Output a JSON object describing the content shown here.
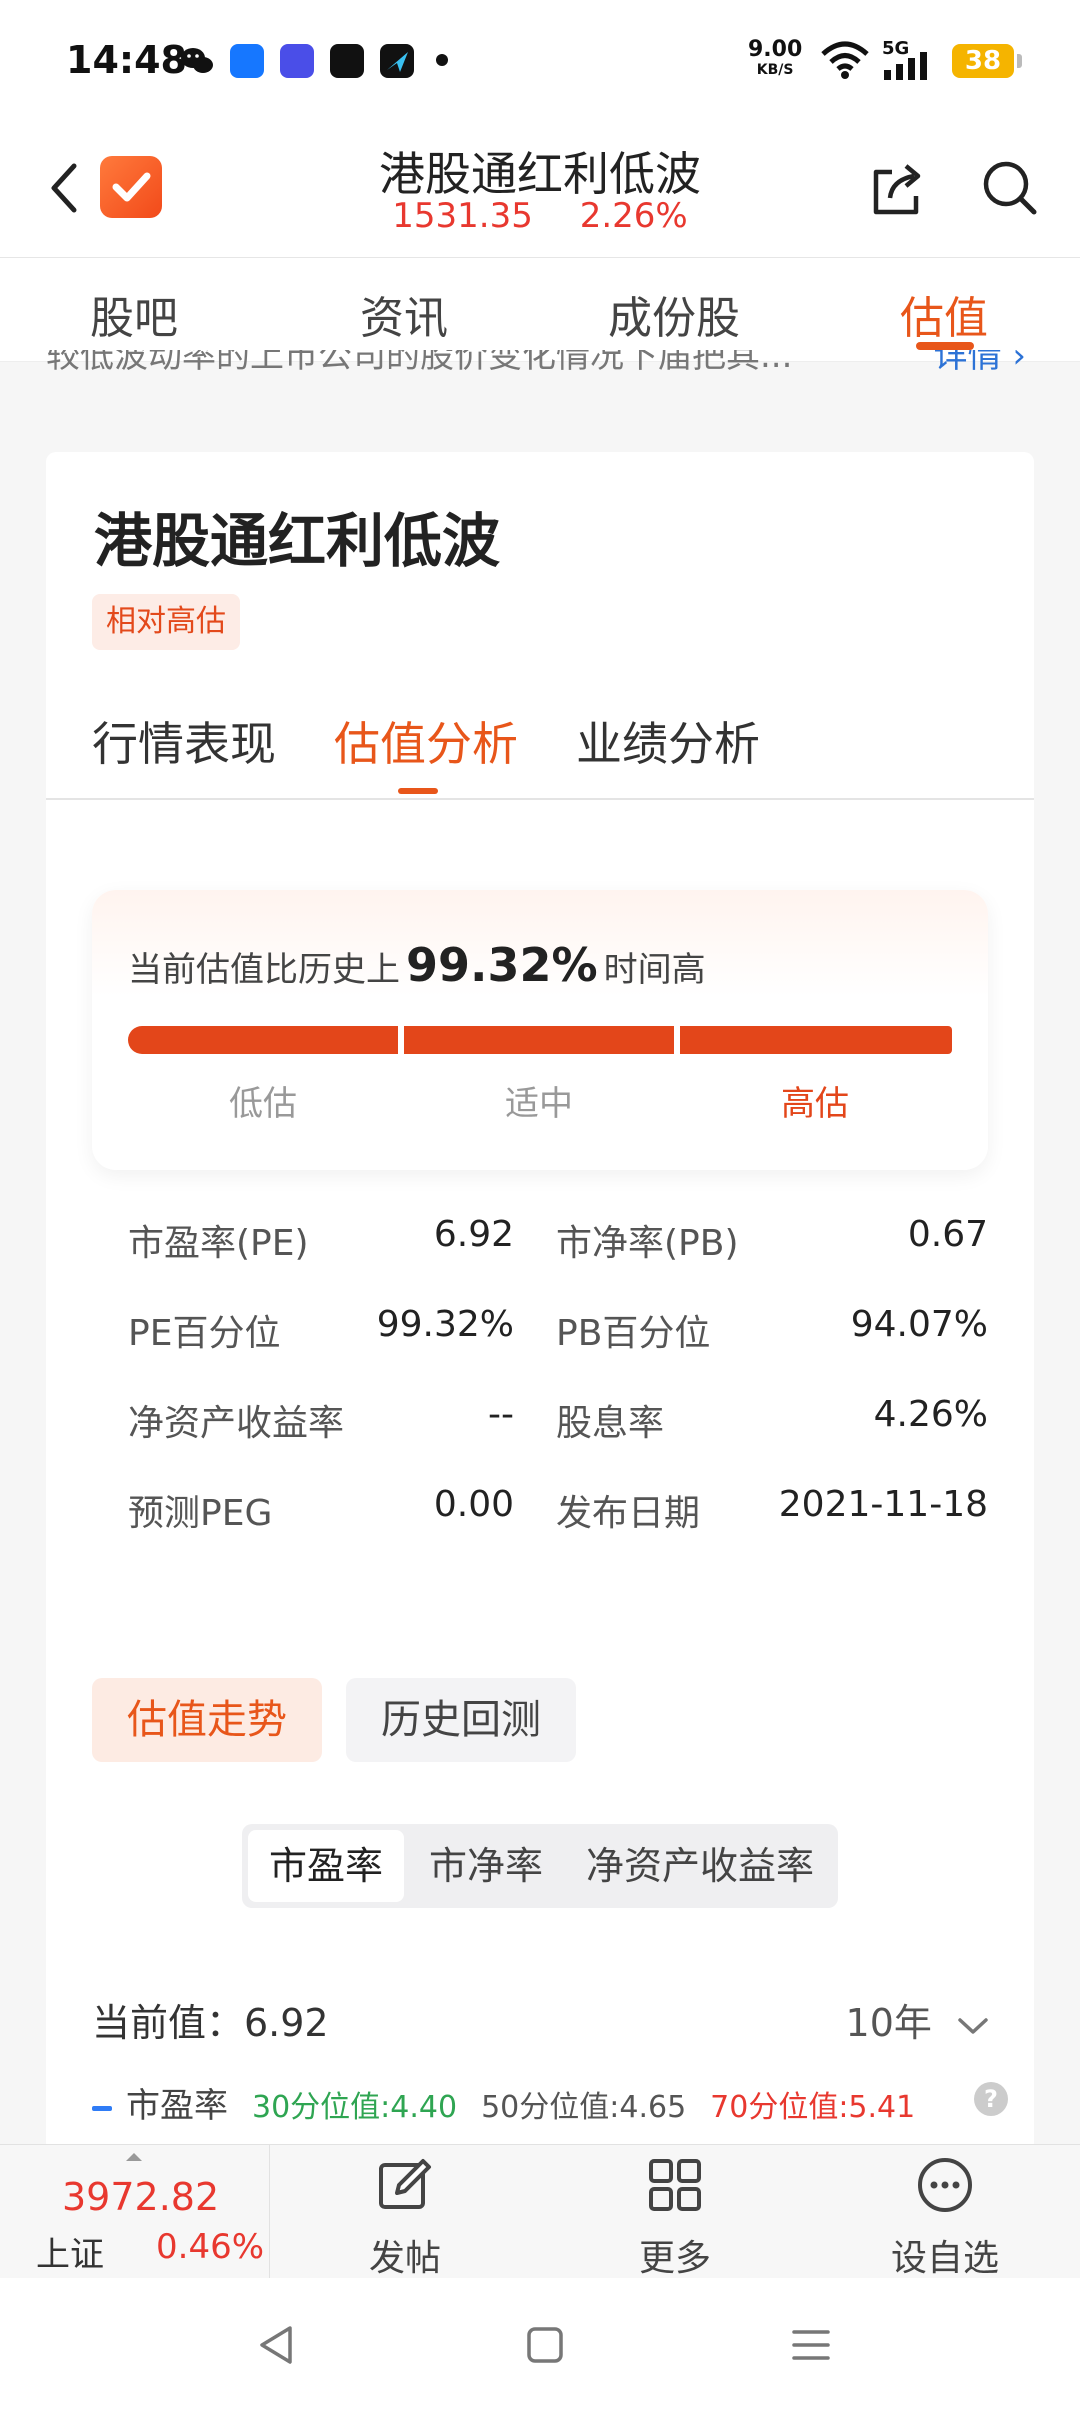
{
  "status_bar": {
    "time": "14:48",
    "net_speed": "9.00",
    "net_unit": "KB/S",
    "network": "5G",
    "battery": "38"
  },
  "header": {
    "title": "港股通红利低波",
    "price": "1531.35",
    "change_pct": "2.26%"
  },
  "top_tabs": [
    "股吧",
    "资讯",
    "成份股",
    "估值"
  ],
  "intro": {
    "text": "较低波动率的上市公司的股价变化情况下届把其...",
    "more": "详情 ›"
  },
  "card": {
    "title": "港股通红利低波",
    "badge": "相对高估",
    "sub_tabs": [
      "行情表现",
      "估值分析",
      "业绩分析"
    ],
    "gauge": {
      "prefix": "当前估值比历史上",
      "percent": "99.32%",
      "suffix": "时间高",
      "labels": [
        "低估",
        "适中",
        "高估"
      ]
    },
    "metrics": [
      {
        "l1": "市盈率(PE)",
        "v1": "6.92",
        "l2": "市净率(PB)",
        "v2": "0.67"
      },
      {
        "l1": "PE百分位",
        "v1": "99.32%",
        "l2": "PB百分位",
        "v2": "94.07%"
      },
      {
        "l1": "净资产收益率",
        "v1": "--",
        "l2": "股息率",
        "v2": "4.26%"
      },
      {
        "l1": "预测PEG",
        "v1": "0.00",
        "l2": "发布日期",
        "v2": "2021-11-18"
      }
    ],
    "segments": [
      "估值走势",
      "历史回测"
    ],
    "toggles": [
      "市盈率",
      "市净率",
      "净资产收益率"
    ],
    "current_value": "当前值：6.92",
    "period": "10年",
    "legend": {
      "series": "市盈率",
      "p30": "30分位值:4.40",
      "p50": "50分位值:4.65",
      "p70": "70分位值:5.41"
    }
  },
  "toolbar": {
    "index_price": "3972.82",
    "index_name": "上证",
    "index_change": "0.46%",
    "post": "发帖",
    "more": "更多",
    "watch": "设自选"
  },
  "colors": {
    "accent": "#e8561a",
    "up_red": "#e8382f",
    "green": "#2fa552"
  }
}
